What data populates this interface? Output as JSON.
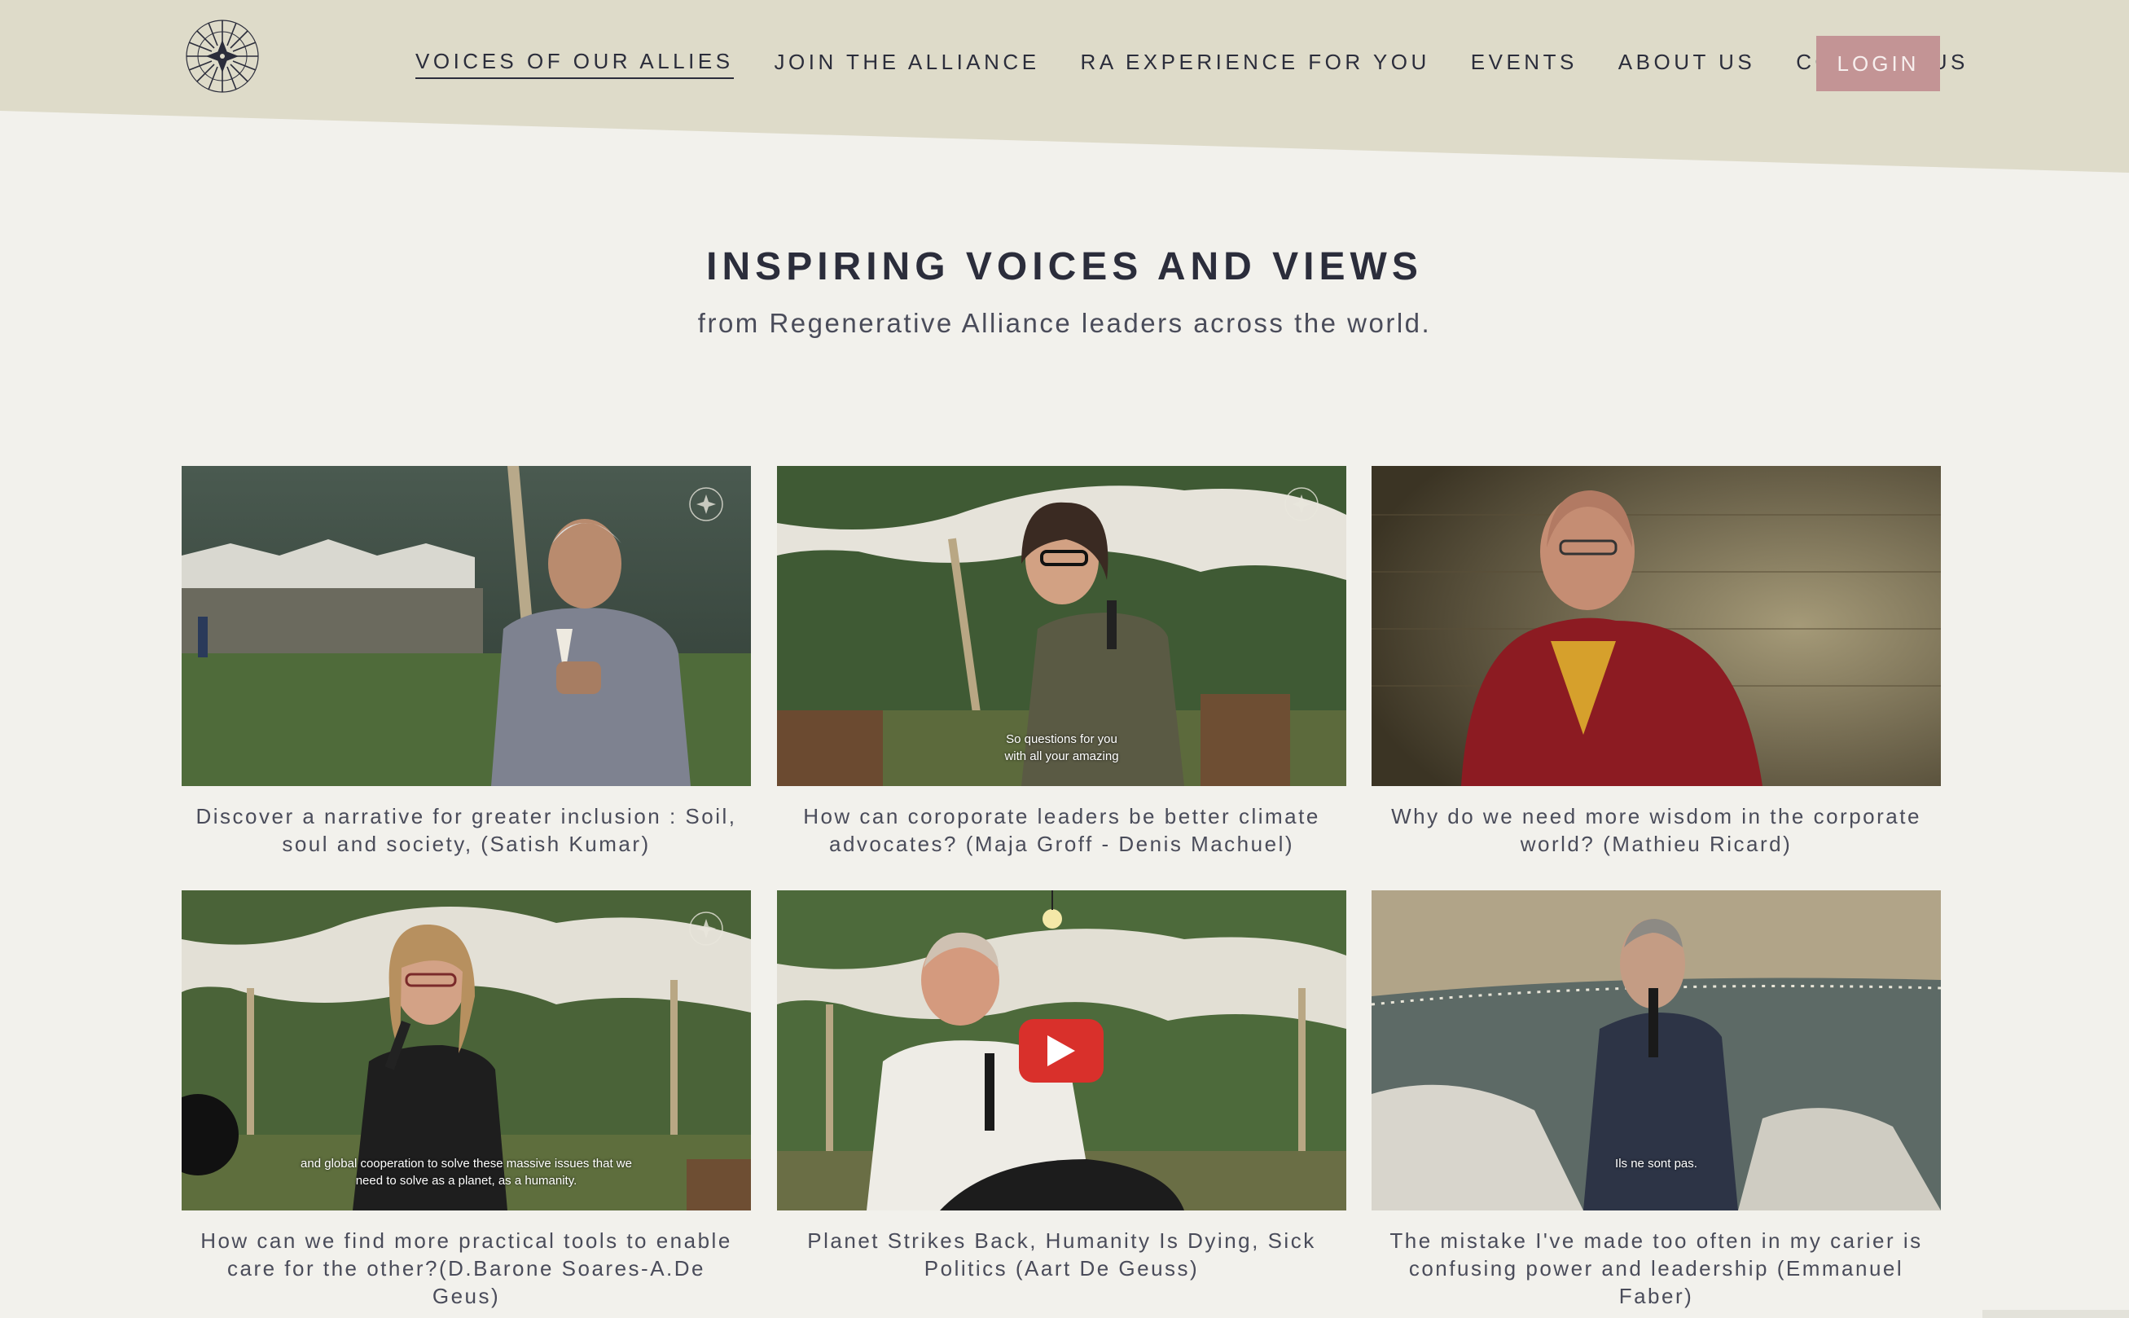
{
  "header": {
    "logo_icon": "compass-rose-icon",
    "nav": [
      {
        "label": "VOICES OF OUR ALLIES",
        "active": true
      },
      {
        "label": "JOIN THE ALLIANCE"
      },
      {
        "label": "RA EXPERIENCE FOR YOU"
      },
      {
        "label": "EVENTS"
      },
      {
        "label": "ABOUT US"
      },
      {
        "label": "CONTACT US"
      }
    ],
    "login_label": "LOGIN"
  },
  "hero": {
    "title": "INSPIRING VOICES AND VIEWS",
    "subtitle": "from Regenerative Alliance leaders across the world."
  },
  "videos": [
    {
      "caption": "Discover a narrative for greater inclusion : Soil, soul and society, (Satish Kumar)",
      "overlay": ""
    },
    {
      "caption": "How can coroporate leaders be better climate advocates? (Maja Groff - Denis Machuel)",
      "overlay_line1": "So questions for you",
      "overlay_line2": "with all your amazing"
    },
    {
      "caption": "Why do we need more wisdom in the corporate world? (Mathieu Ricard)",
      "overlay": ""
    },
    {
      "caption": "How can we find more practical tools to enable care for the other?(D.Barone Soares-A.De Geus)",
      "overlay_line1": "and global cooperation to solve these massive issues that we",
      "overlay_line2": "need to solve as a planet, as a humanity."
    },
    {
      "caption": "Planet Strikes Back, Humanity Is Dying, Sick Politics (Aart De Geuss)",
      "play_icon": "youtube-play-icon"
    },
    {
      "caption": "The mistake I've made too often in my carier is confusing power and leadership (Emmanuel Faber)",
      "overlay_line1": "Ils ne sont pas."
    }
  ],
  "colors": {
    "header_bg": "#dedbc9",
    "page_bg": "#f2f1ec",
    "login_bg": "#c39495",
    "text": "#2b2d3b",
    "play": "#d9302b"
  }
}
